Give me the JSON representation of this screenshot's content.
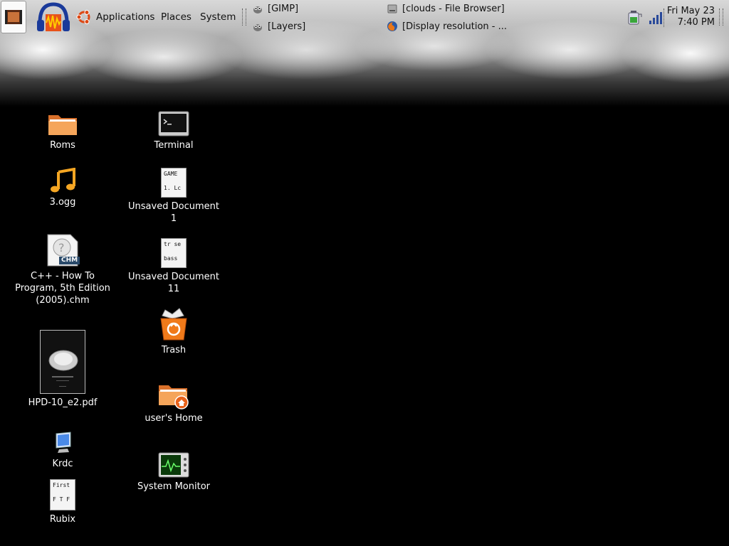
{
  "panel": {
    "menus": {
      "applications": "Applications",
      "places": "Places",
      "system": "System"
    },
    "tasks": {
      "gimp": "[GIMP]",
      "layers": "[Layers]",
      "file_browser": "[clouds - File Browser]",
      "display_resolution": "[Display resolution - ..."
    },
    "clock": {
      "date": "Fri May 23",
      "time": "7:40 PM"
    }
  },
  "desktop": {
    "icons": {
      "roms": "Roms",
      "ogg": "3.ogg",
      "chm_line1": "C++ - How To",
      "chm_line2": "Program, 5th Edition",
      "chm_line3": "(2005).chm",
      "chm_badge": "CHM",
      "pdf": "HPD-10_e2.pdf",
      "krdc": "Krdc",
      "rubix": "Rubix",
      "rubix_thumb": "First\n\nF T F",
      "terminal": "Terminal",
      "doc1_line1": "Unsaved Document",
      "doc1_line2": "1",
      "doc1_thumb": "GAME\n\n1. Lc",
      "doc11_line1": "Unsaved Document",
      "doc11_line2": "11",
      "doc11_thumb": "tr se\n\nbass",
      "trash": "Trash",
      "home": "user's Home",
      "sysmon": "System Monitor"
    }
  },
  "colors": {
    "folder": "#f08a30",
    "note": "#f5a623",
    "text": "#ffffff"
  }
}
